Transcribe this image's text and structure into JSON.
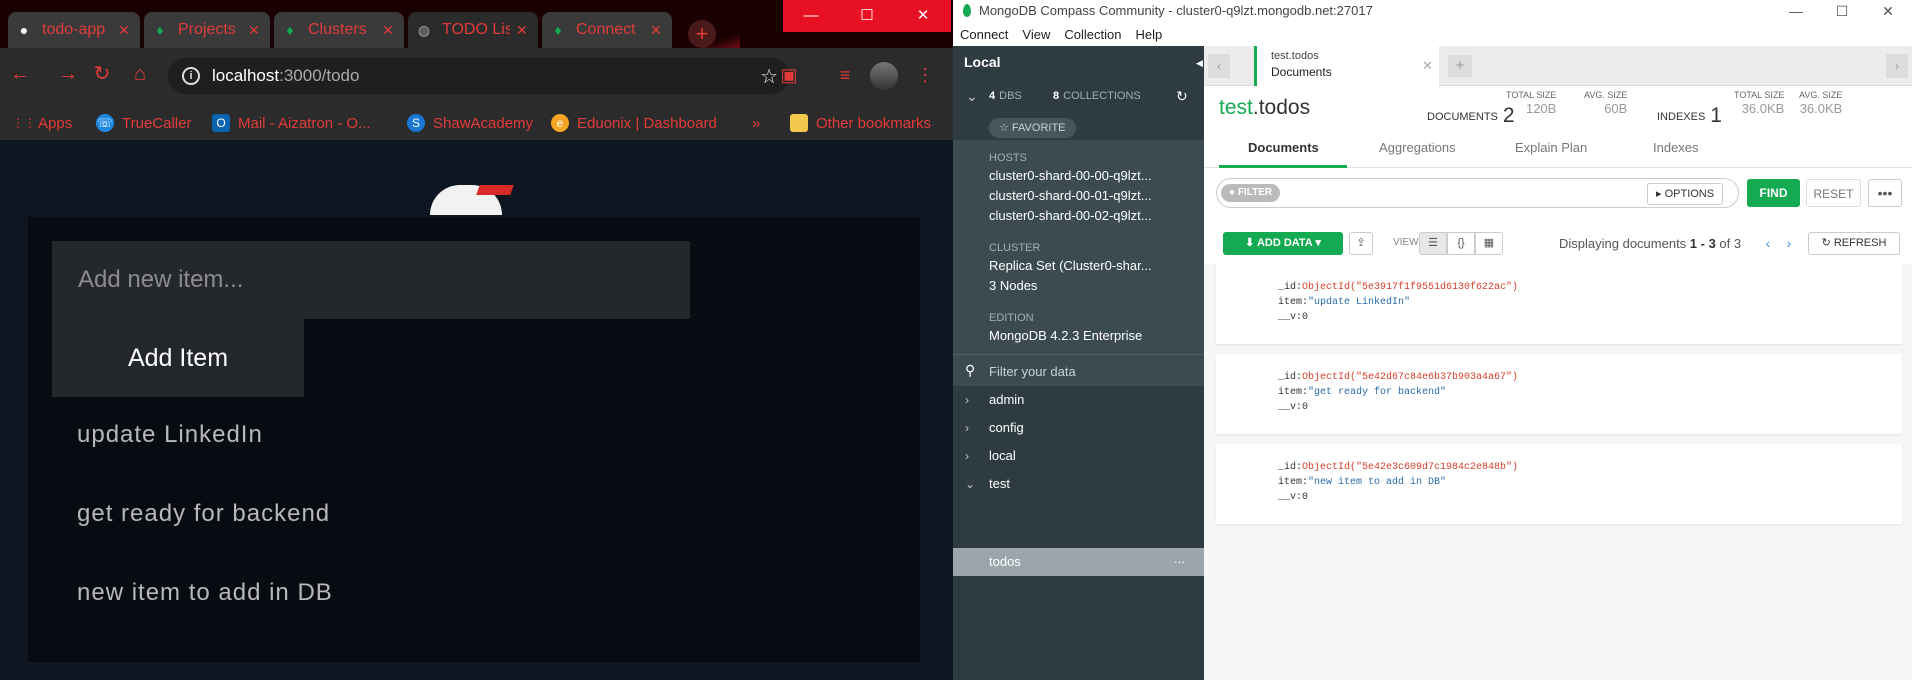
{
  "browser": {
    "tabs": [
      {
        "title": "todo-app",
        "icon": "github-icon"
      },
      {
        "title": "Projects",
        "icon": "mongodb-leaf-icon"
      },
      {
        "title": "Clusters",
        "icon": "mongodb-leaf-icon"
      },
      {
        "title": "TODO List",
        "icon": "globe-icon"
      },
      {
        "title": "Connect",
        "icon": "mongodb-leaf-icon"
      }
    ],
    "url_host": "localhost",
    "url_path": ":3000/todo",
    "bookmarks": [
      {
        "label": "Apps"
      },
      {
        "label": "TrueCaller"
      },
      {
        "label": "Mail - Aizatron - O..."
      },
      {
        "label": "ShawAcademy"
      },
      {
        "label": "Eduonix | Dashboard"
      },
      {
        "label": "»"
      },
      {
        "label": "Other bookmarks"
      }
    ],
    "accent_color": "#e23b3b"
  },
  "todo_app": {
    "input_placeholder": "Add new item...",
    "add_button": "Add Item",
    "items": [
      "update LinkedIn",
      "get ready for backend",
      "new item to add in DB"
    ]
  },
  "compass": {
    "window_title": "MongoDB Compass Community - cluster0-q9lzt.mongodb.net:27017",
    "menu": [
      "Connect",
      "View",
      "Collection",
      "Help"
    ],
    "sidebar": {
      "title": "Local",
      "dbs_count": "4",
      "dbs_label": "DBS",
      "collections_count": "8",
      "collections_label": "COLLECTIONS",
      "favorite": "☆ FAVORITE",
      "hosts_label": "HOSTS",
      "hosts": [
        "cluster0-shard-00-00-q9lzt...",
        "cluster0-shard-00-01-q9lzt...",
        "cluster0-shard-00-02-q9lzt..."
      ],
      "cluster_label": "CLUSTER",
      "cluster_value": "Replica Set (Cluster0-shar...",
      "cluster_nodes": "3 Nodes",
      "edition_label": "EDITION",
      "edition_value": "MongoDB 4.2.3 Enterprise",
      "filter_placeholder": "Filter your data",
      "databases": [
        "admin",
        "config",
        "local",
        "test"
      ],
      "selected_collection": "todos",
      "more": "..."
    },
    "tab": {
      "namespace": "test.todos",
      "view": "Documents"
    },
    "header": {
      "db": "test",
      "coll": ".todos",
      "documents_label": "DOCUMENTS",
      "documents_count": "2",
      "total_size_label": "TOTAL SIZE",
      "total_size": "120B",
      "avg_size_label": "AVG. SIZE",
      "avg_size": "60B",
      "indexes_label": "INDEXES",
      "indexes_count": "1",
      "idx_total_size": "36.0KB",
      "idx_avg_size": "36.0KB"
    },
    "subtabs": [
      "Documents",
      "Aggregations",
      "Explain Plan",
      "Indexes"
    ],
    "filter": {
      "tag": "FILTER",
      "options": "OPTIONS",
      "find": "FIND",
      "reset": "RESET",
      "more": "•••"
    },
    "toolbar": {
      "add_data": "ADD DATA",
      "view_label": "VIEW",
      "displaying_prefix": "Displaying documents ",
      "range": "1 - 3",
      "of_total": " of 3",
      "refresh": "REFRESH"
    },
    "documents": [
      {
        "_id": "ObjectId(\"5e3917f1f9551d6130f622ac\")",
        "item": "\"update LinkedIn\"",
        "__v": "0"
      },
      {
        "_id": "ObjectId(\"5e42d67c84e6b37b903a4a67\")",
        "item": "\"get ready for backend\"",
        "__v": "0"
      },
      {
        "_id": "ObjectId(\"5e42e3c609d7c1984c2e848b\")",
        "item": "\"new item to add in DB\"",
        "__v": "0"
      }
    ],
    "accent_color": "#13aa52"
  }
}
